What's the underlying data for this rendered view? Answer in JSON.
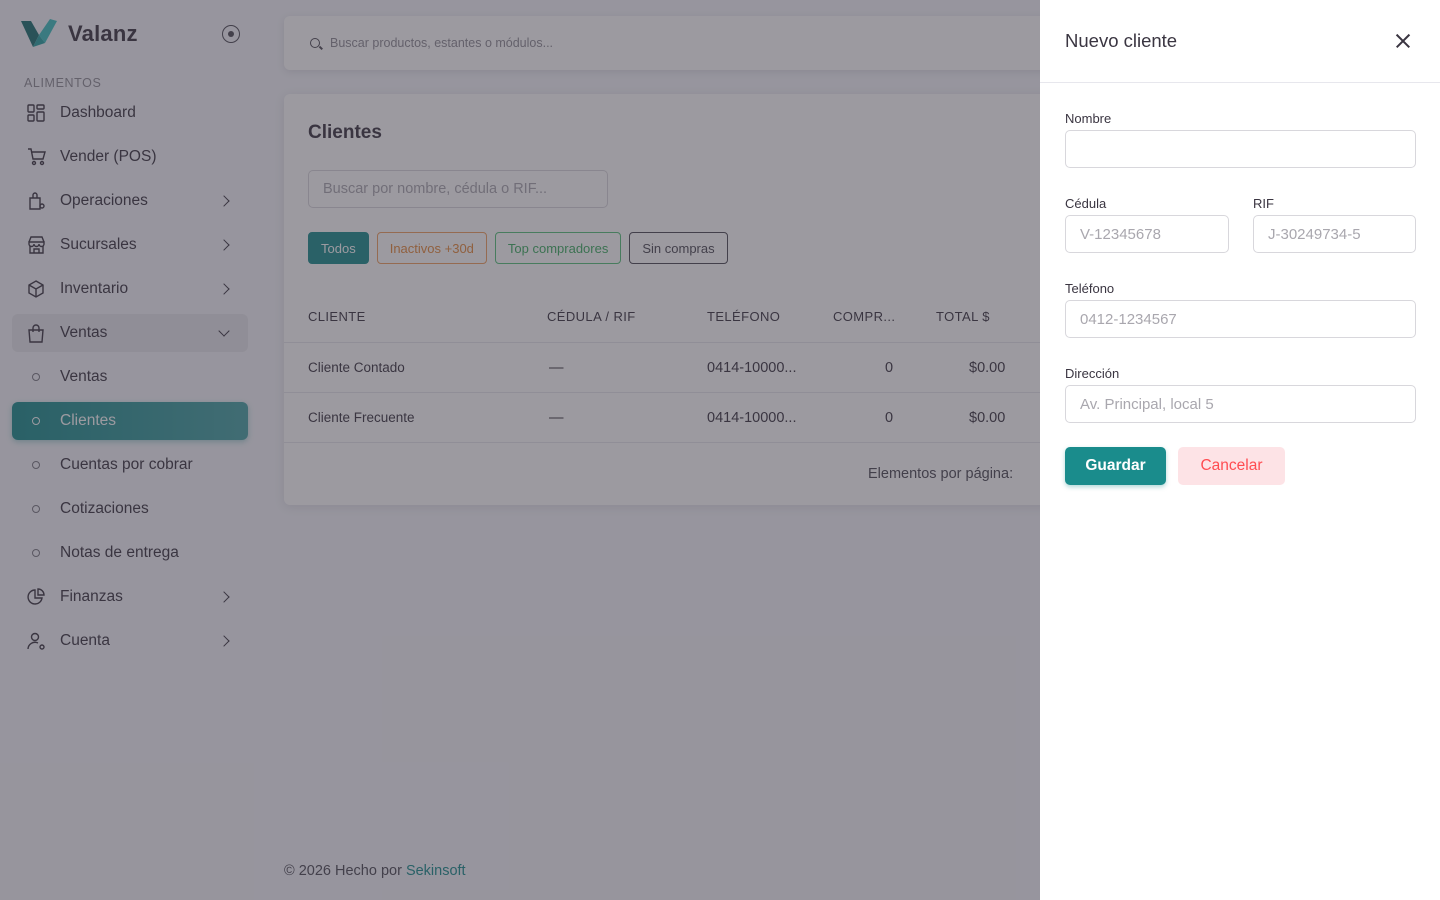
{
  "brand": {
    "name": "Valanz"
  },
  "sidebar": {
    "section": "ALIMENTOS",
    "items": [
      {
        "label": "Dashboard",
        "icon": "dashboard-icon"
      },
      {
        "label": "Vender (POS)",
        "icon": "cart-icon"
      },
      {
        "label": "Operaciones",
        "icon": "operations-icon"
      },
      {
        "label": "Sucursales",
        "icon": "store-icon"
      },
      {
        "label": "Inventario",
        "icon": "box-icon"
      },
      {
        "label": "Ventas",
        "icon": "shopping-bag-icon"
      },
      {
        "label": "Ventas",
        "icon": "circle-icon"
      },
      {
        "label": "Clientes",
        "icon": "circle-icon"
      },
      {
        "label": "Cuentas por cobrar",
        "icon": "circle-icon"
      },
      {
        "label": "Cotizaciones",
        "icon": "circle-icon"
      },
      {
        "label": "Notas de entrega",
        "icon": "circle-icon"
      },
      {
        "label": "Finanzas",
        "icon": "pie-chart-icon"
      },
      {
        "label": "Cuenta",
        "icon": "user-settings-icon"
      }
    ]
  },
  "topbar": {
    "search_placeholder": "Buscar productos, estantes o módulos..."
  },
  "clients": {
    "title": "Clientes",
    "search_placeholder": "Buscar por nombre, cédula o RIF...",
    "filters": [
      "Todos",
      "Inactivos +30d",
      "Top compradores",
      "Sin compras"
    ],
    "columns": [
      "CLIENTE",
      "CÉDULA / RIF",
      "TELÉFONO",
      "COMPR...",
      "TOTAL $"
    ],
    "rows": [
      {
        "cliente": "Cliente Contado",
        "cedula": "—",
        "telefono": "0414-10000...",
        "compras": "0",
        "total": "$0.00"
      },
      {
        "cliente": "Cliente Frecuente",
        "cedula": "—",
        "telefono": "0414-10000...",
        "compras": "0",
        "total": "$0.00"
      }
    ],
    "pager_label": "Elementos por página:"
  },
  "footer": {
    "text": "© 2026 Hecho por ",
    "link": "Sekinsoft"
  },
  "drawer": {
    "title": "Nuevo cliente",
    "nombre_label": "Nombre",
    "nombre_value": "",
    "cedula_label": "Cédula",
    "cedula_placeholder": "V-12345678",
    "rif_label": "RIF",
    "rif_placeholder": "J-30249734-5",
    "telefono_label": "Teléfono",
    "telefono_placeholder": "0412-1234567",
    "direccion_label": "Dirección",
    "direccion_placeholder": "Av. Principal, local 5",
    "save": "Guardar",
    "cancel": "Cancelar"
  },
  "colors": {
    "accent": "#1a8c8c",
    "danger": "#ff4c51"
  }
}
